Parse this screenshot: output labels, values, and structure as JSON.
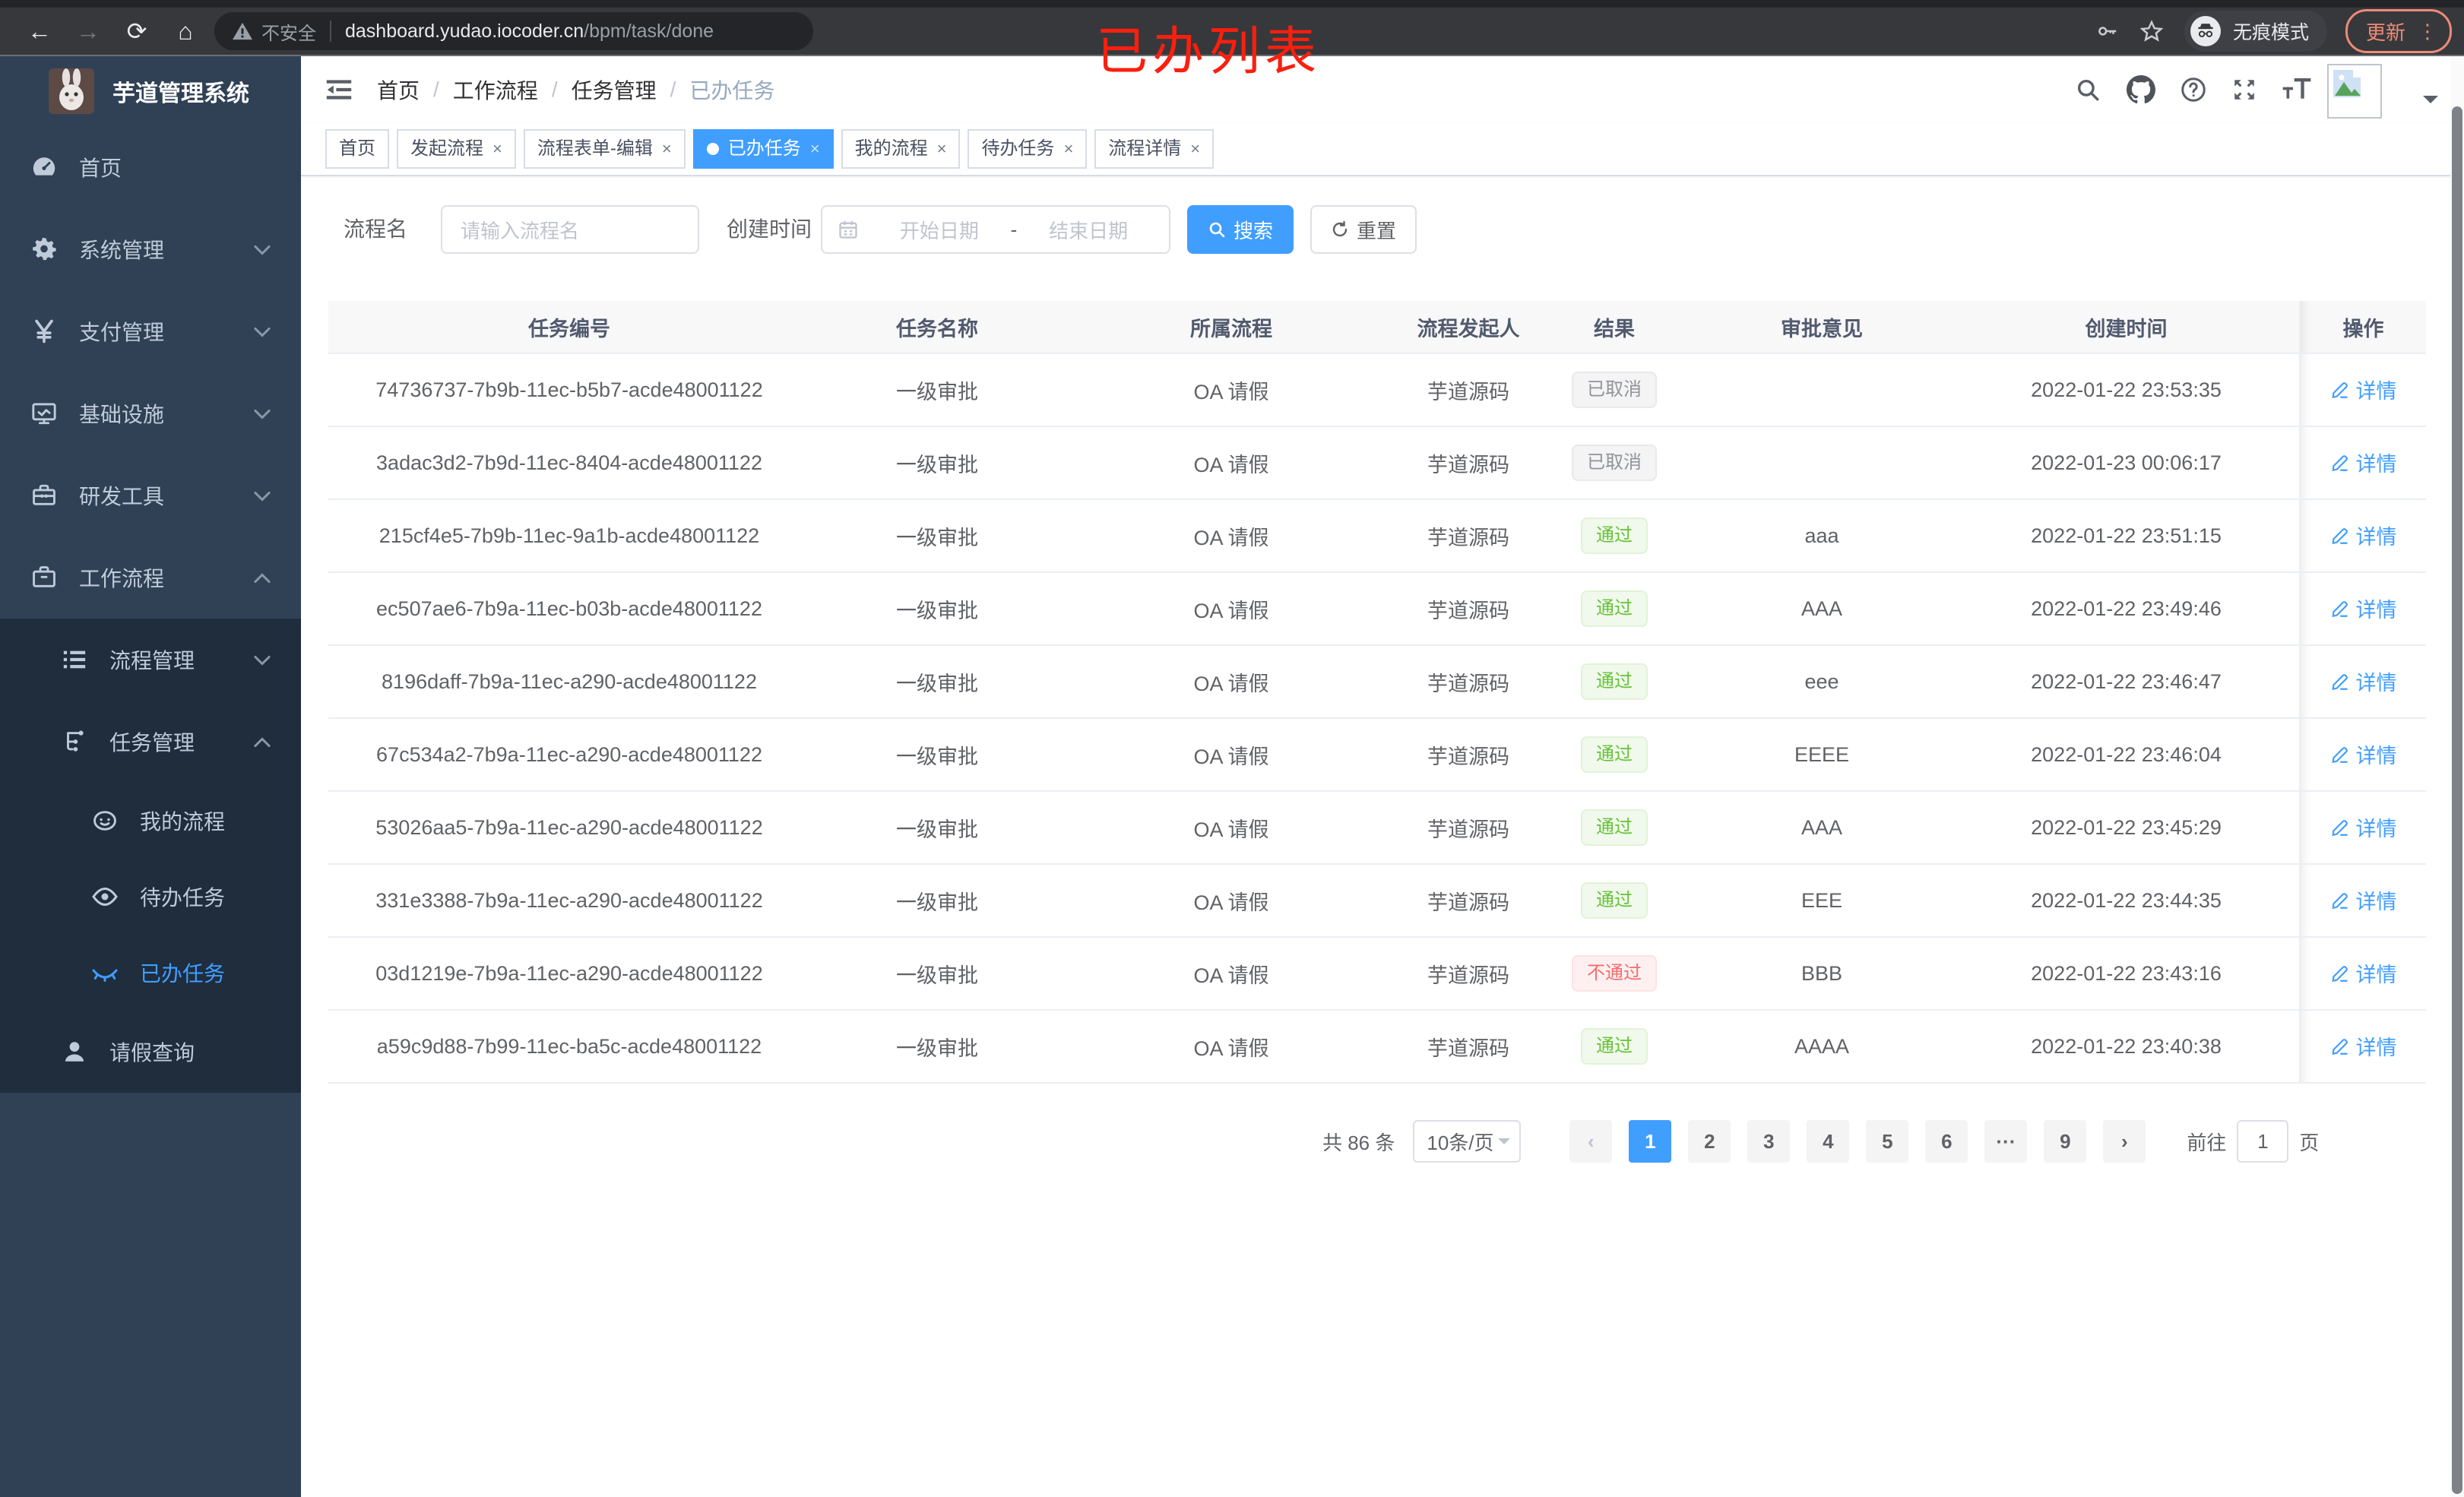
{
  "browser": {
    "security_text": "不安全",
    "url_host": "dashboard.yudao.iocoder.cn",
    "url_path": "/bpm/task/done",
    "incognito_label": "无痕模式",
    "update_label": "更新",
    "annotation": "已办列表"
  },
  "sidebar": {
    "title": "芋道管理系统",
    "menu": [
      {
        "label": "首页",
        "icon": "dashboard-icon",
        "level": 1,
        "chevron": "",
        "sub": false,
        "active": false
      },
      {
        "label": "系统管理",
        "icon": "gear-icon",
        "level": 1,
        "chevron": "down",
        "sub": false,
        "active": false
      },
      {
        "label": "支付管理",
        "icon": "yen-icon",
        "level": 1,
        "chevron": "down",
        "sub": false,
        "active": false
      },
      {
        "label": "基础设施",
        "icon": "monitor-icon",
        "level": 1,
        "chevron": "down",
        "sub": false,
        "active": false
      },
      {
        "label": "研发工具",
        "icon": "toolbox-icon",
        "level": 1,
        "chevron": "down",
        "sub": false,
        "active": false
      },
      {
        "label": "工作流程",
        "icon": "briefcase-icon",
        "level": 1,
        "chevron": "up",
        "sub": false,
        "active": false
      },
      {
        "label": "流程管理",
        "icon": "list-tree-icon",
        "level": 2,
        "chevron": "down",
        "sub": true,
        "active": false
      },
      {
        "label": "任务管理",
        "icon": "flow-icon",
        "level": 2,
        "chevron": "up",
        "sub": true,
        "active": false
      },
      {
        "label": "我的流程",
        "icon": "user-face-icon",
        "level": 3,
        "chevron": "",
        "sub": true,
        "active": false
      },
      {
        "label": "待办任务",
        "icon": "eye-open-icon",
        "level": 3,
        "chevron": "",
        "sub": true,
        "active": false
      },
      {
        "label": "已办任务",
        "icon": "eye-closed-icon",
        "level": 3,
        "chevron": "",
        "sub": true,
        "active": true
      },
      {
        "label": "请假查询",
        "icon": "person-icon",
        "level": 2,
        "chevron": "",
        "sub": true,
        "active": false
      }
    ]
  },
  "navbar": {
    "breadcrumb": [
      "首页",
      "工作流程",
      "任务管理",
      "已办任务"
    ],
    "separator": "/"
  },
  "tags": [
    {
      "label": "首页",
      "closable": false,
      "active": false
    },
    {
      "label": "发起流程",
      "closable": true,
      "active": false
    },
    {
      "label": "流程表单-编辑",
      "closable": true,
      "active": false
    },
    {
      "label": "已办任务",
      "closable": true,
      "active": true
    },
    {
      "label": "我的流程",
      "closable": true,
      "active": false
    },
    {
      "label": "待办任务",
      "closable": true,
      "active": false
    },
    {
      "label": "流程详情",
      "closable": true,
      "active": false
    }
  ],
  "filters": {
    "name_label": "流程名",
    "name_placeholder": "请输入流程名",
    "time_label": "创建时间",
    "start_placeholder": "开始日期",
    "date_separator": "-",
    "end_placeholder": "结束日期",
    "search_label": "搜索",
    "reset_label": "重置"
  },
  "table": {
    "headers": [
      "任务编号",
      "任务名称",
      "所属流程",
      "流程发起人",
      "结果",
      "审批意见",
      "创建时间",
      "操作"
    ],
    "action_label": "详情",
    "rows": [
      {
        "id": "74736737-7b9b-11ec-b5b7-acde48001122",
        "name": "一级审批",
        "process": "OA 请假",
        "starter": "芋道源码",
        "result": "已取消",
        "result_type": "info",
        "opinion": "",
        "time": "2022-01-22 23:53:35"
      },
      {
        "id": "3adac3d2-7b9d-11ec-8404-acde48001122",
        "name": "一级审批",
        "process": "OA 请假",
        "starter": "芋道源码",
        "result": "已取消",
        "result_type": "info",
        "opinion": "",
        "time": "2022-01-23 00:06:17"
      },
      {
        "id": "215cf4e5-7b9b-11ec-9a1b-acde48001122",
        "name": "一级审批",
        "process": "OA 请假",
        "starter": "芋道源码",
        "result": "通过",
        "result_type": "success",
        "opinion": "aaa",
        "time": "2022-01-22 23:51:15"
      },
      {
        "id": "ec507ae6-7b9a-11ec-b03b-acde48001122",
        "name": "一级审批",
        "process": "OA 请假",
        "starter": "芋道源码",
        "result": "通过",
        "result_type": "success",
        "opinion": "AAA",
        "time": "2022-01-22 23:49:46"
      },
      {
        "id": "8196daff-7b9a-11ec-a290-acde48001122",
        "name": "一级审批",
        "process": "OA 请假",
        "starter": "芋道源码",
        "result": "通过",
        "result_type": "success",
        "opinion": "eee",
        "time": "2022-01-22 23:46:47"
      },
      {
        "id": "67c534a2-7b9a-11ec-a290-acde48001122",
        "name": "一级审批",
        "process": "OA 请假",
        "starter": "芋道源码",
        "result": "通过",
        "result_type": "success",
        "opinion": "EEEE",
        "time": "2022-01-22 23:46:04"
      },
      {
        "id": "53026aa5-7b9a-11ec-a290-acde48001122",
        "name": "一级审批",
        "process": "OA 请假",
        "starter": "芋道源码",
        "result": "通过",
        "result_type": "success",
        "opinion": "AAA",
        "time": "2022-01-22 23:45:29"
      },
      {
        "id": "331e3388-7b9a-11ec-a290-acde48001122",
        "name": "一级审批",
        "process": "OA 请假",
        "starter": "芋道源码",
        "result": "通过",
        "result_type": "success",
        "opinion": "EEE",
        "time": "2022-01-22 23:44:35"
      },
      {
        "id": "03d1219e-7b9a-11ec-a290-acde48001122",
        "name": "一级审批",
        "process": "OA 请假",
        "starter": "芋道源码",
        "result": "不通过",
        "result_type": "danger",
        "opinion": "BBB",
        "time": "2022-01-22 23:43:16"
      },
      {
        "id": "a59c9d88-7b99-11ec-ba5c-acde48001122",
        "name": "一级审批",
        "process": "OA 请假",
        "starter": "芋道源码",
        "result": "通过",
        "result_type": "success",
        "opinion": "AAAA",
        "time": "2022-01-22 23:40:38"
      }
    ]
  },
  "pagination": {
    "total": "共 86 条",
    "page_size": "10条/页",
    "pages": [
      "1",
      "2",
      "3",
      "4",
      "5",
      "6",
      "···",
      "9"
    ],
    "active_page": "1",
    "goto_label": "前往",
    "goto_value": "1",
    "goto_suffix": "页"
  },
  "colors": {
    "accent": "#409eff",
    "sidebar_bg": "#304156",
    "submenu_bg": "#1f2d3d",
    "success": "#67c23a",
    "danger": "#f56c6c",
    "info": "#909399",
    "annotation_red": "#fb1f0e"
  }
}
